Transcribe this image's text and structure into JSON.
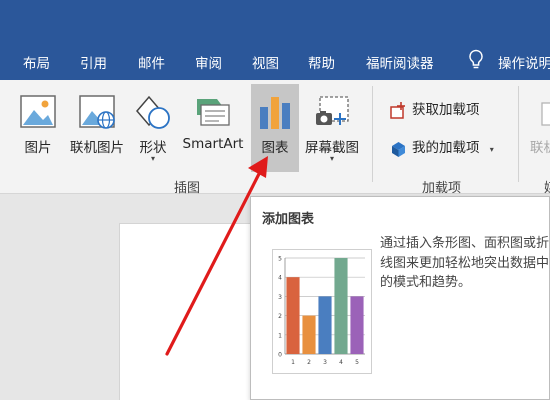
{
  "menu": {
    "tabs": [
      "布局",
      "引用",
      "邮件",
      "审阅",
      "视图",
      "帮助",
      "福昕阅读器"
    ],
    "tell_me": "操作说明"
  },
  "ribbon": {
    "illustrations": {
      "group_label": "插图",
      "buttons": {
        "pictures": "图片",
        "online_pictures": "联机图片",
        "shapes": "形状",
        "smartart": "SmartArt",
        "chart": "图表",
        "screenshot": "屏幕截图"
      },
      "dropdown_glyph": "▾"
    },
    "addins": {
      "group_label": "加载项",
      "get_addins": "获取加载项",
      "my_addins": "我的加载项",
      "dropdown_glyph": "▾"
    },
    "next_group": {
      "partial_button": "联机",
      "partial_label": "媒"
    }
  },
  "tooltip": {
    "title": "添加图表",
    "description": "通过插入条形图、面积图或折线图来更加轻松地突出数据中的模式和趋势。"
  },
  "chart_data": {
    "type": "bar",
    "categories": [
      "1",
      "2",
      "3",
      "4",
      "5"
    ],
    "values": [
      4,
      2,
      3,
      5,
      3
    ],
    "ylim": [
      0,
      5
    ],
    "y_ticks": [
      "0",
      "1",
      "2",
      "3",
      "4",
      "5"
    ],
    "grid": true,
    "colors": [
      "#d9633e",
      "#e8903f",
      "#4a7ec0",
      "#72a98f",
      "#9b62b8"
    ]
  },
  "colors": {
    "menubar": "#2b579a",
    "ribbon": "#f3f3f3",
    "highlight": "#c6c6c6",
    "arrow": "#e01b1b"
  }
}
